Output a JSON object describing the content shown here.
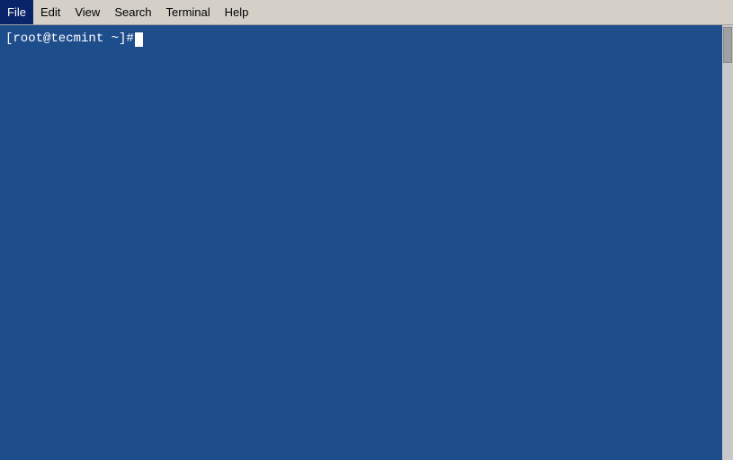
{
  "menubar": {
    "items": [
      {
        "id": "file",
        "label": "File"
      },
      {
        "id": "edit",
        "label": "Edit"
      },
      {
        "id": "view",
        "label": "View"
      },
      {
        "id": "search",
        "label": "Search"
      },
      {
        "id": "terminal",
        "label": "Terminal"
      },
      {
        "id": "help",
        "label": "Help"
      }
    ]
  },
  "terminal": {
    "prompt": "[root@tecmint ~]# "
  },
  "colors": {
    "terminal_bg": "#1e4d8c",
    "menubar_bg": "#d4d0c8"
  }
}
